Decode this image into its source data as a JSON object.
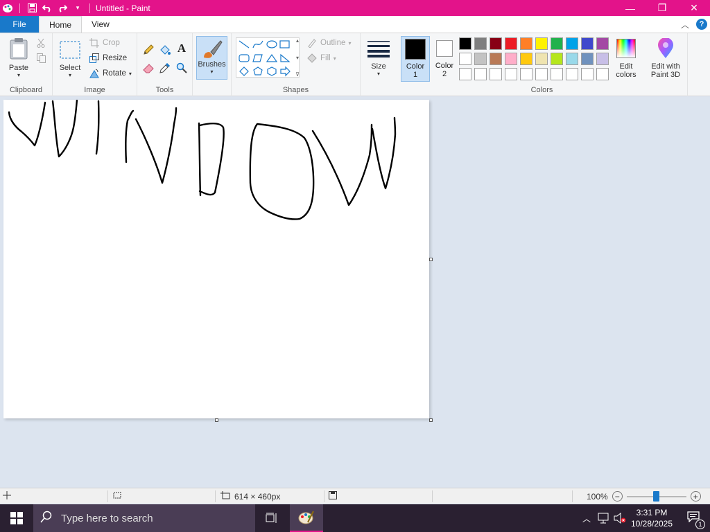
{
  "window": {
    "title": "Untitled - Paint",
    "min_glyph": "—",
    "max_glyph": "❐",
    "close_glyph": "✕"
  },
  "tabs": {
    "file": "File",
    "home": "Home",
    "view": "View"
  },
  "ribbon": {
    "clipboard": {
      "label": "Clipboard",
      "paste": "Paste"
    },
    "image": {
      "label": "Image",
      "select": "Select",
      "crop": "Crop",
      "resize": "Resize",
      "rotate": "Rotate"
    },
    "tools": {
      "label": "Tools",
      "text_glyph": "A"
    },
    "brushes": {
      "label": "Brushes"
    },
    "shapes": {
      "label": "Shapes",
      "outline": "Outline",
      "fill": "Fill"
    },
    "size": {
      "label": "Size"
    },
    "color1": {
      "label1": "Color",
      "label2": "1"
    },
    "color2": {
      "label1": "Color",
      "label2": "2"
    },
    "colors": {
      "label": "Colors",
      "row1": [
        "#000000",
        "#7f7f7f",
        "#880015",
        "#ed1c24",
        "#ff7f27",
        "#fff200",
        "#22b14c",
        "#00a2e8",
        "#3f48cc",
        "#a349a4"
      ],
      "row2": [
        "#ffffff",
        "#c3c3c3",
        "#b97a57",
        "#ffaec9",
        "#ffc90e",
        "#efe4b0",
        "#b5e61d",
        "#99d9ea",
        "#7092be",
        "#c8bfe7"
      ],
      "row3": [
        "#ffffff",
        "#ffffff",
        "#ffffff",
        "#ffffff",
        "#ffffff",
        "#ffffff",
        "#ffffff",
        "#ffffff",
        "#ffffff",
        "#ffffff"
      ]
    },
    "edit_colors": {
      "line1": "Edit",
      "line2": "colors"
    },
    "paint3d": {
      "line1": "Edit with",
      "line2": "Paint 3D"
    }
  },
  "status": {
    "dimensions": "614 × 460px",
    "zoom": "100%",
    "zoom_fraction": 0.5
  },
  "taskbar": {
    "search_placeholder": "Type here to search",
    "time": "3:31 PM",
    "date": "10/28/2025",
    "notification_count": "1"
  }
}
